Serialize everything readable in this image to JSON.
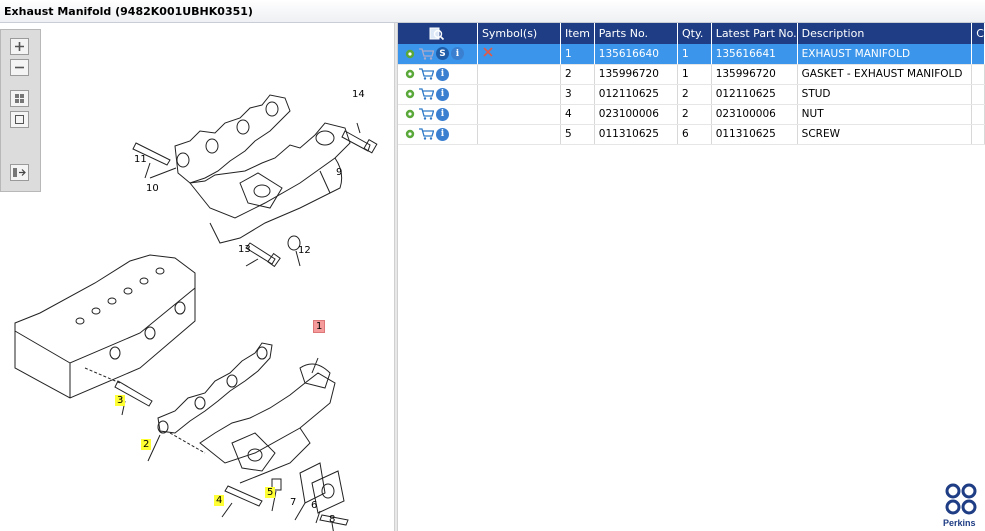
{
  "window": {
    "title": "Exhaust Manifold (9482K001UBHK0351)"
  },
  "toolbox": {
    "tools": [
      {
        "name": "zoom-in-icon"
      },
      {
        "name": "zoom-out-icon"
      },
      {
        "name": "fit-all-icon"
      },
      {
        "name": "fit-window-icon"
      },
      {
        "name": "export-list-icon"
      }
    ]
  },
  "callouts": [
    {
      "label": "14",
      "style": "plain"
    },
    {
      "label": "11",
      "style": "plain"
    },
    {
      "label": "10",
      "style": "plain"
    },
    {
      "label": "9",
      "style": "plain"
    },
    {
      "label": "13",
      "style": "plain"
    },
    {
      "label": "12",
      "style": "plain"
    },
    {
      "label": "1",
      "style": "selected"
    },
    {
      "label": "3",
      "style": "highlight"
    },
    {
      "label": "2",
      "style": "highlight"
    },
    {
      "label": "4",
      "style": "highlight"
    },
    {
      "label": "5",
      "style": "highlight"
    },
    {
      "label": "7",
      "style": "plain"
    },
    {
      "label": "6",
      "style": "plain"
    },
    {
      "label": "8",
      "style": "plain"
    }
  ],
  "grid": {
    "columns": [
      "",
      "Symbol(s)",
      "Item",
      "Parts No.",
      "Qty.",
      "Latest Part No.",
      "Description",
      "C"
    ],
    "rows": [
      {
        "item": "1",
        "parts_no": "135616640",
        "qty": "1",
        "latest": "135616641",
        "description": "EXHAUST MANIFOLD",
        "selected": true,
        "has_s": true,
        "symbol": "remove-x-icon"
      },
      {
        "item": "2",
        "parts_no": "135996720",
        "qty": "1",
        "latest": "135996720",
        "description": "GASKET - EXHAUST MANIFOLD",
        "selected": false,
        "has_s": false,
        "symbol": ""
      },
      {
        "item": "3",
        "parts_no": "012110625",
        "qty": "2",
        "latest": "012110625",
        "description": "STUD",
        "selected": false,
        "has_s": false,
        "symbol": ""
      },
      {
        "item": "4",
        "parts_no": "023100006",
        "qty": "2",
        "latest": "023100006",
        "description": "NUT",
        "selected": false,
        "has_s": false,
        "symbol": ""
      },
      {
        "item": "5",
        "parts_no": "011310625",
        "qty": "6",
        "latest": "011310625",
        "description": "SCREW",
        "selected": false,
        "has_s": false,
        "symbol": ""
      }
    ],
    "badge_s": "S",
    "badge_i": "i"
  },
  "brand": {
    "name": "Perkins"
  },
  "colors": {
    "header": "#1e3d84",
    "selected_row": "#3b95ea",
    "highlight": "#ffff33",
    "selected_callout": "#f59b9b"
  }
}
